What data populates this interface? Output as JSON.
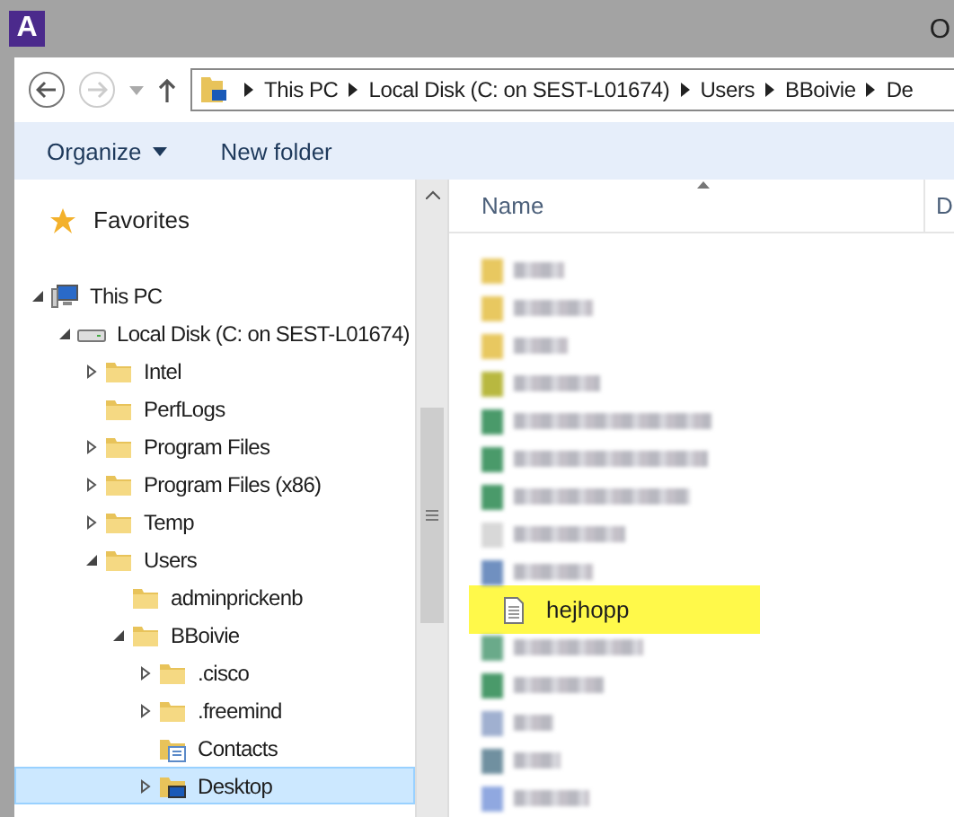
{
  "window": {
    "logo": "A",
    "title": "O"
  },
  "breadcrumb": [
    "This PC",
    "Local Disk (C: on SEST-L01674)",
    "Users",
    "BBoivie",
    "De"
  ],
  "toolbar": {
    "organize": "Organize",
    "new_folder": "New folder"
  },
  "navigation": {
    "favorites": "Favorites",
    "tree": [
      {
        "label": "This PC",
        "kind": "pc",
        "expandable": true,
        "expanded": true,
        "selected": false,
        "children": [
          {
            "label": "Local Disk (C: on SEST-L01674)",
            "kind": "drive",
            "expandable": true,
            "expanded": true,
            "selected": false,
            "children": [
              {
                "label": "Intel",
                "kind": "folder",
                "expandable": true,
                "expanded": false,
                "selected": false
              },
              {
                "label": "PerfLogs",
                "kind": "folder",
                "expandable": false,
                "selected": false
              },
              {
                "label": "Program Files",
                "kind": "folder",
                "expandable": true,
                "expanded": false,
                "selected": false
              },
              {
                "label": "Program Files (x86)",
                "kind": "folder",
                "expandable": true,
                "expanded": false,
                "selected": false
              },
              {
                "label": "Temp",
                "kind": "folder",
                "expandable": true,
                "expanded": false,
                "selected": false
              },
              {
                "label": "Users",
                "kind": "folder",
                "expandable": true,
                "expanded": true,
                "selected": false,
                "children": [
                  {
                    "label": "adminprickenb",
                    "kind": "folder",
                    "expandable": false,
                    "selected": false
                  },
                  {
                    "label": "BBoivie",
                    "kind": "folder",
                    "expandable": true,
                    "expanded": true,
                    "selected": false,
                    "children": [
                      {
                        "label": ".cisco",
                        "kind": "folder",
                        "expandable": true,
                        "expanded": false,
                        "selected": false
                      },
                      {
                        "label": ".freemind",
                        "kind": "folder",
                        "expandable": true,
                        "expanded": false,
                        "selected": false
                      },
                      {
                        "label": "Contacts",
                        "kind": "contacts",
                        "expandable": false,
                        "selected": false
                      },
                      {
                        "label": "Desktop",
                        "kind": "desktop",
                        "expandable": true,
                        "expanded": false,
                        "selected": true
                      }
                    ]
                  }
                ]
              }
            ]
          }
        ]
      }
    ]
  },
  "file_list": {
    "columns": [
      "Name",
      "D"
    ],
    "rows": [
      {
        "kind": "blurred",
        "color": "#e8c860"
      },
      {
        "kind": "blurred",
        "color": "#e8c860"
      },
      {
        "kind": "blurred",
        "color": "#e8c860"
      },
      {
        "kind": "blurred",
        "color": "#b8b840"
      },
      {
        "kind": "blurred",
        "color": "#4a9a6a"
      },
      {
        "kind": "blurred",
        "color": "#4a9a6a"
      },
      {
        "kind": "blurred",
        "color": "#4a9a6a"
      },
      {
        "kind": "blurred",
        "color": "#d8d8d8"
      },
      {
        "kind": "blurred",
        "color": "#7090c0"
      },
      {
        "kind": "file",
        "name": "hejhopp",
        "highlighted": true
      },
      {
        "kind": "blurred",
        "color": "#6aaa8a"
      },
      {
        "kind": "blurred",
        "color": "#4a9a6a"
      },
      {
        "kind": "blurred",
        "color": "#a0b0d0"
      },
      {
        "kind": "blurred",
        "color": "#7090a0"
      },
      {
        "kind": "blurred",
        "color": "#90a8e0"
      }
    ]
  }
}
